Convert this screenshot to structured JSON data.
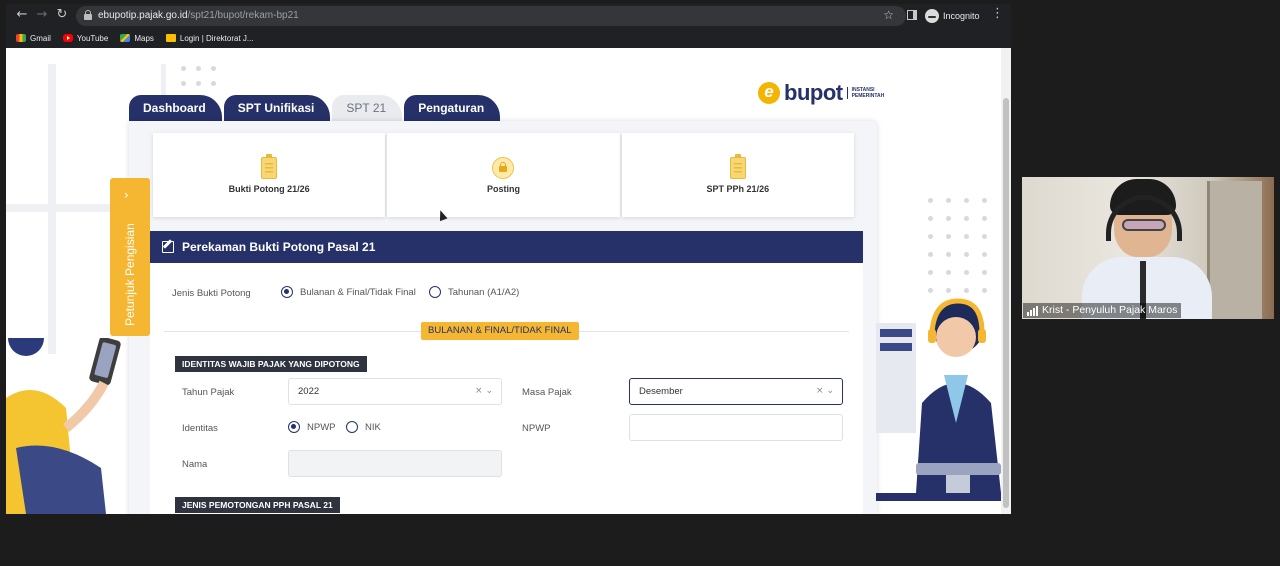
{
  "browser": {
    "url_host": "ebupotip.pajak.go.id",
    "url_path": "/spt21/bupot/rekam-bp21",
    "profile_label": "Incognito",
    "bookmarks": [
      {
        "label": "Gmail",
        "icon": "gmail-icon"
      },
      {
        "label": "YouTube",
        "icon": "youtube-icon"
      },
      {
        "label": "Maps",
        "icon": "maps-icon"
      },
      {
        "label": "Login | Direktorat J...",
        "icon": "bookmark-icon"
      }
    ]
  },
  "logo": {
    "letter": "e",
    "text": "bupot",
    "sub_line1": "INSTANSI",
    "sub_line2": "PEMERINTAH"
  },
  "tabs": [
    {
      "label": "Dashboard",
      "active": false
    },
    {
      "label": "SPT Unifikasi",
      "active": false
    },
    {
      "label": "SPT 21",
      "active": true
    },
    {
      "label": "Pengaturan",
      "active": false
    }
  ],
  "cards": [
    {
      "label": "Bukti Potong 21/26",
      "icon": "clipboard-icon"
    },
    {
      "label": "Posting",
      "icon": "lock-icon"
    },
    {
      "label": "SPT PPh 21/26",
      "icon": "clipboard-icon"
    }
  ],
  "side_tab": {
    "label": "Petunjuk Pengisian",
    "icon": "chevron-right-icon"
  },
  "form": {
    "title": "Perekaman Bukti Potong Pasal 21",
    "jenis_label": "Jenis Bukti Potong",
    "jenis_options": [
      {
        "label": "Bulanan & Final/Tidak Final",
        "selected": true
      },
      {
        "label": "Tahunan (A1/A2)",
        "selected": false
      }
    ],
    "section_pill": "BULANAN & FINAL/TIDAK FINAL",
    "identitas_section": "IDENTITAS WAJIB PAJAK YANG DIPOTONG",
    "tahun_label": "Tahun Pajak",
    "tahun_value": "2022",
    "masa_label": "Masa Pajak",
    "masa_value": "Desember",
    "identitas_label": "Identitas",
    "identitas_options": [
      {
        "label": "NPWP",
        "selected": true
      },
      {
        "label": "NIK",
        "selected": false
      }
    ],
    "npwp_label": "NPWP",
    "nama_label": "Nama",
    "pemotongan_section": "JENIS PEMOTONGAN PPH PASAL 21"
  },
  "video": {
    "participant_name": "Krist - Penyuluh Pajak Maros"
  },
  "colors": {
    "navy": "#253168",
    "accent_yellow": "#f5b731"
  }
}
